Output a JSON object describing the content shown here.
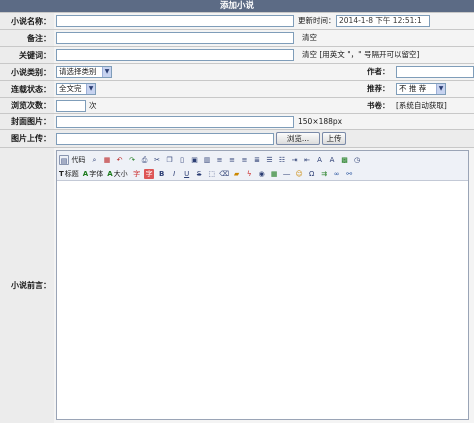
{
  "header": {
    "title": "添加小说"
  },
  "fields": {
    "title_label": "小说名称：",
    "update_time_label": "更新时间：",
    "update_time_value": "2014-1-8 下午 12:51:1",
    "remark_label": "备注：",
    "remark_clear": "清空",
    "keywords_label": "关键词：",
    "keywords_hint": "清空 [用英文 \"，\" 号隔开可以留空]",
    "category_label": "小说类别：",
    "category_value": "请选择类别",
    "author_label": "作者：",
    "status_label": "连载状态：",
    "status_value": "全文完",
    "recommend_label": "推荐：",
    "recommend_value": "不 推 荐",
    "views_label": "浏览次数：",
    "views_unit": "次",
    "shelf_label": "书卷：",
    "shelf_value": "[系统自动获取]",
    "cover_label": "封面图片：",
    "cover_hint": "150×188px",
    "upload_label": "图片上传：",
    "browse_button": "浏览...",
    "upload_button": "上传",
    "preface_label": "小说前言："
  },
  "toolbar": {
    "row1_code_label": "代码",
    "row2_labels": {
      "title": "标题",
      "font": "字体",
      "size": "大小"
    },
    "row1_icons": [
      "code-icon",
      "search-icon",
      "grid-icon",
      "undo-icon",
      "redo-icon",
      "print-icon",
      "cut-icon",
      "copy-icon",
      "paste-icon",
      "paste-text-icon",
      "paste-word-icon",
      "align-left-icon",
      "align-center-icon",
      "align-right-icon",
      "align-justify-icon",
      "ordered-list-icon",
      "unordered-list-icon",
      "indent-icon",
      "outdent-icon",
      "subscript-icon",
      "superscript-icon",
      "date-icon",
      "time-icon"
    ],
    "row2_icons": [
      "title-icon",
      "font-icon",
      "font-size-icon",
      "text-color-icon",
      "bg-color-icon",
      "bold-icon",
      "italic-icon",
      "underline-icon",
      "strike-icon",
      "select-all-icon",
      "remove-format-icon",
      "image-icon",
      "flash-icon",
      "media-icon",
      "table-icon",
      "hr-icon",
      "emoticon-icon",
      "special-char-icon",
      "pagebreak-icon",
      "link-icon",
      "unlink-icon"
    ]
  },
  "colors": {
    "header_bg": "#5c6b85",
    "label_bg": "#ececec",
    "row_bg": "#f4f4f4"
  }
}
